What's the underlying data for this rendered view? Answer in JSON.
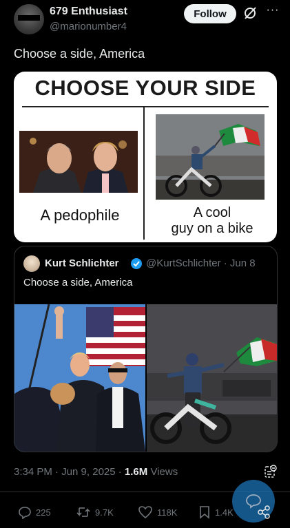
{
  "author": {
    "name": "679 Enthusiast",
    "handle": "@marionumber4",
    "follow_label": "Follow",
    "more_label": "···"
  },
  "tweet": {
    "text": "Choose a side, America"
  },
  "meme": {
    "title": "CHOOSE YOUR SIDE",
    "left_caption": "A pedophile",
    "right_caption_line1": "A cool",
    "right_caption_line2": "guy on a bike"
  },
  "quote": {
    "name": "Kurt Schlichter",
    "handle_date": "@KurtSchlichter · Jun 8",
    "text": "Choose a side, America"
  },
  "meta": {
    "time_date": "3:34 PM · Jun 9, 2025 · ",
    "views_count": "1.6M",
    "views_label": " Views"
  },
  "actions": {
    "replies": "225",
    "reposts": "9.7K",
    "likes": "118K",
    "bookmarks": "1.4K"
  },
  "colors": {
    "background": "#000000",
    "text": "#e7e9ea",
    "muted": "#71767b",
    "verified": "#1d9bf0",
    "fab": "#1d73b7"
  }
}
